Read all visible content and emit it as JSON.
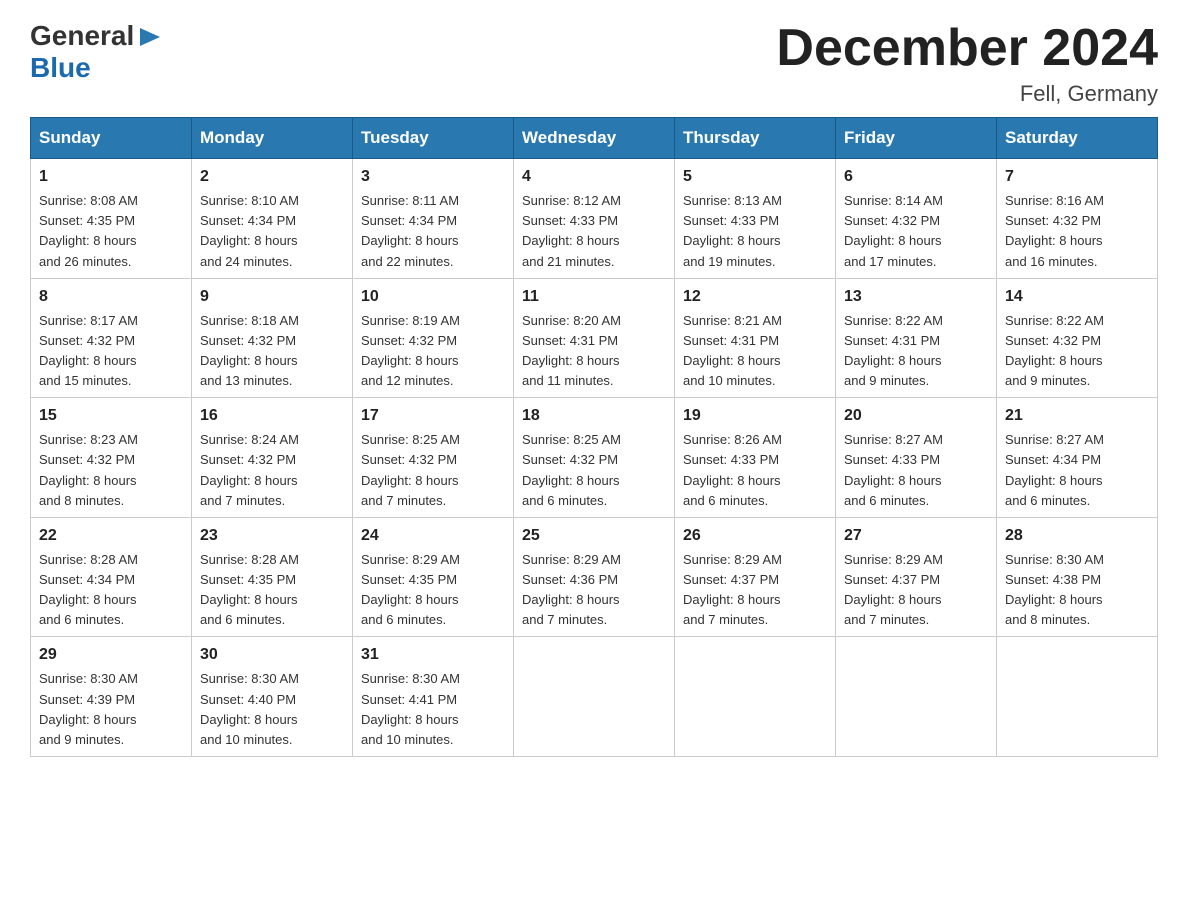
{
  "logo": {
    "general": "General",
    "blue": "Blue",
    "tagline": ""
  },
  "header": {
    "title": "December 2024",
    "subtitle": "Fell, Germany"
  },
  "calendar": {
    "days_of_week": [
      "Sunday",
      "Monday",
      "Tuesday",
      "Wednesday",
      "Thursday",
      "Friday",
      "Saturday"
    ],
    "weeks": [
      [
        {
          "date": "1",
          "sunrise": "8:08 AM",
          "sunset": "4:35 PM",
          "daylight": "8 hours and 26 minutes."
        },
        {
          "date": "2",
          "sunrise": "8:10 AM",
          "sunset": "4:34 PM",
          "daylight": "8 hours and 24 minutes."
        },
        {
          "date": "3",
          "sunrise": "8:11 AM",
          "sunset": "4:34 PM",
          "daylight": "8 hours and 22 minutes."
        },
        {
          "date": "4",
          "sunrise": "8:12 AM",
          "sunset": "4:33 PM",
          "daylight": "8 hours and 21 minutes."
        },
        {
          "date": "5",
          "sunrise": "8:13 AM",
          "sunset": "4:33 PM",
          "daylight": "8 hours and 19 minutes."
        },
        {
          "date": "6",
          "sunrise": "8:14 AM",
          "sunset": "4:32 PM",
          "daylight": "8 hours and 17 minutes."
        },
        {
          "date": "7",
          "sunrise": "8:16 AM",
          "sunset": "4:32 PM",
          "daylight": "8 hours and 16 minutes."
        }
      ],
      [
        {
          "date": "8",
          "sunrise": "8:17 AM",
          "sunset": "4:32 PM",
          "daylight": "8 hours and 15 minutes."
        },
        {
          "date": "9",
          "sunrise": "8:18 AM",
          "sunset": "4:32 PM",
          "daylight": "8 hours and 13 minutes."
        },
        {
          "date": "10",
          "sunrise": "8:19 AM",
          "sunset": "4:32 PM",
          "daylight": "8 hours and 12 minutes."
        },
        {
          "date": "11",
          "sunrise": "8:20 AM",
          "sunset": "4:31 PM",
          "daylight": "8 hours and 11 minutes."
        },
        {
          "date": "12",
          "sunrise": "8:21 AM",
          "sunset": "4:31 PM",
          "daylight": "8 hours and 10 minutes."
        },
        {
          "date": "13",
          "sunrise": "8:22 AM",
          "sunset": "4:31 PM",
          "daylight": "8 hours and 9 minutes."
        },
        {
          "date": "14",
          "sunrise": "8:22 AM",
          "sunset": "4:32 PM",
          "daylight": "8 hours and 9 minutes."
        }
      ],
      [
        {
          "date": "15",
          "sunrise": "8:23 AM",
          "sunset": "4:32 PM",
          "daylight": "8 hours and 8 minutes."
        },
        {
          "date": "16",
          "sunrise": "8:24 AM",
          "sunset": "4:32 PM",
          "daylight": "8 hours and 7 minutes."
        },
        {
          "date": "17",
          "sunrise": "8:25 AM",
          "sunset": "4:32 PM",
          "daylight": "8 hours and 7 minutes."
        },
        {
          "date": "18",
          "sunrise": "8:25 AM",
          "sunset": "4:32 PM",
          "daylight": "8 hours and 6 minutes."
        },
        {
          "date": "19",
          "sunrise": "8:26 AM",
          "sunset": "4:33 PM",
          "daylight": "8 hours and 6 minutes."
        },
        {
          "date": "20",
          "sunrise": "8:27 AM",
          "sunset": "4:33 PM",
          "daylight": "8 hours and 6 minutes."
        },
        {
          "date": "21",
          "sunrise": "8:27 AM",
          "sunset": "4:34 PM",
          "daylight": "8 hours and 6 minutes."
        }
      ],
      [
        {
          "date": "22",
          "sunrise": "8:28 AM",
          "sunset": "4:34 PM",
          "daylight": "8 hours and 6 minutes."
        },
        {
          "date": "23",
          "sunrise": "8:28 AM",
          "sunset": "4:35 PM",
          "daylight": "8 hours and 6 minutes."
        },
        {
          "date": "24",
          "sunrise": "8:29 AM",
          "sunset": "4:35 PM",
          "daylight": "8 hours and 6 minutes."
        },
        {
          "date": "25",
          "sunrise": "8:29 AM",
          "sunset": "4:36 PM",
          "daylight": "8 hours and 7 minutes."
        },
        {
          "date": "26",
          "sunrise": "8:29 AM",
          "sunset": "4:37 PM",
          "daylight": "8 hours and 7 minutes."
        },
        {
          "date": "27",
          "sunrise": "8:29 AM",
          "sunset": "4:37 PM",
          "daylight": "8 hours and 7 minutes."
        },
        {
          "date": "28",
          "sunrise": "8:30 AM",
          "sunset": "4:38 PM",
          "daylight": "8 hours and 8 minutes."
        }
      ],
      [
        {
          "date": "29",
          "sunrise": "8:30 AM",
          "sunset": "4:39 PM",
          "daylight": "8 hours and 9 minutes."
        },
        {
          "date": "30",
          "sunrise": "8:30 AM",
          "sunset": "4:40 PM",
          "daylight": "8 hours and 10 minutes."
        },
        {
          "date": "31",
          "sunrise": "8:30 AM",
          "sunset": "4:41 PM",
          "daylight": "8 hours and 10 minutes."
        },
        null,
        null,
        null,
        null
      ]
    ],
    "labels": {
      "sunrise": "Sunrise:",
      "sunset": "Sunset:",
      "daylight": "Daylight:"
    }
  }
}
